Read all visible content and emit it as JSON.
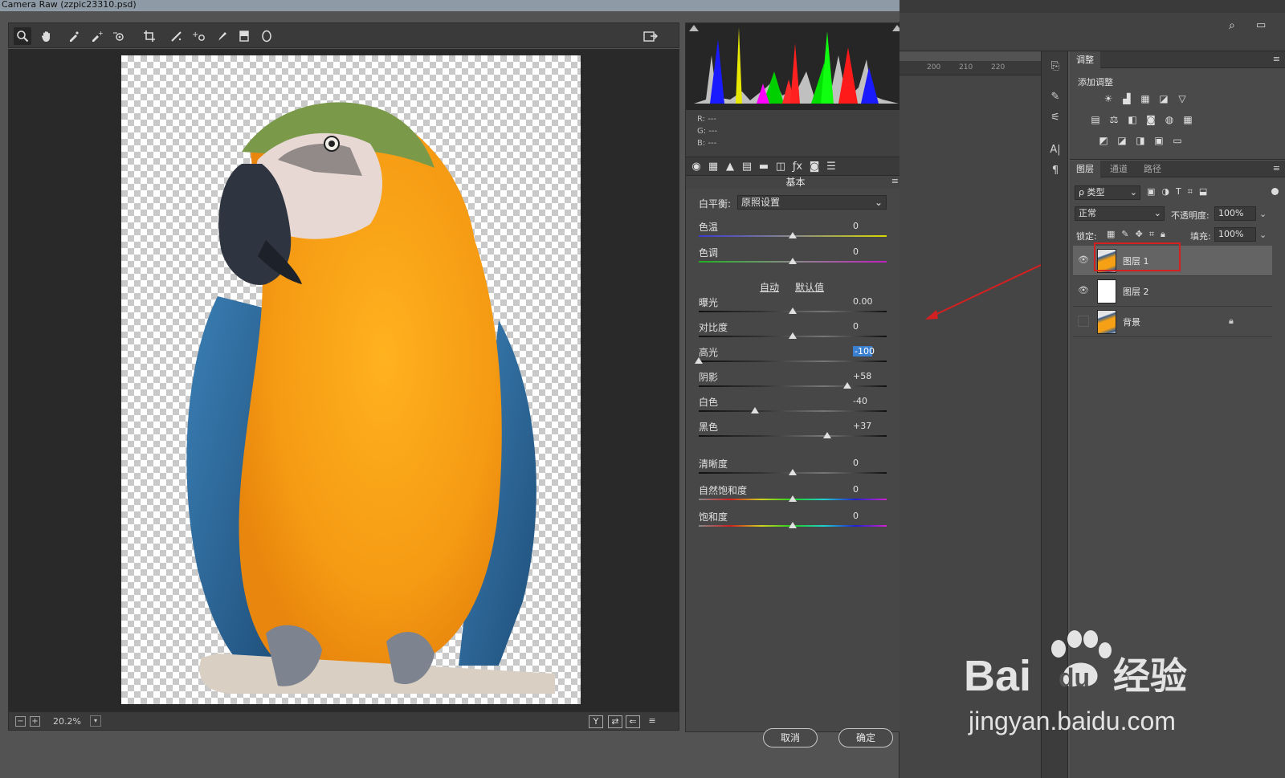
{
  "window": {
    "title": "Camera Raw (zzpic23310.psd)"
  },
  "toolbar": {
    "tools": [
      {
        "icon": "zoom-icon",
        "glyph": "🔍︎"
      },
      {
        "icon": "hand-icon",
        "glyph": "✋︎"
      },
      {
        "icon": "white-balance-icon",
        "glyph": "⁄"
      },
      {
        "icon": "color-sampler-icon",
        "glyph": "✧"
      },
      {
        "icon": "targeted-adjustment-icon",
        "glyph": "◎"
      },
      {
        "icon": "crop-icon",
        "glyph": "⌗"
      },
      {
        "icon": "straighten-icon",
        "glyph": "⟋"
      },
      {
        "icon": "spot-removal-icon",
        "glyph": "+o"
      },
      {
        "icon": "red-eye-icon",
        "glyph": "⊙"
      },
      {
        "icon": "adjustment-brush-icon",
        "glyph": "✎"
      },
      {
        "icon": "graduated-filter-icon",
        "glyph": "▯"
      },
      {
        "icon": "radial-filter-icon",
        "glyph": "○"
      }
    ],
    "export_icon": "↱"
  },
  "status": {
    "zoom": "20.2%",
    "zoom_minus": "−",
    "zoom_plus": "+",
    "btn_y": "Y",
    "btn_swap": "⇄",
    "btn_copy": "⇐",
    "btn_prefs": "≡"
  },
  "histogram": {
    "r": "R:  ---",
    "g": "G:  ---",
    "b": "B:  ---"
  },
  "panel": {
    "section_title": "基本",
    "section_menu": "≡",
    "tab_icons": [
      "◉",
      "▦",
      "▲",
      "▤",
      "▬",
      "◫",
      "ƒx",
      "◙",
      "☰"
    ],
    "white_balance_label": "白平衡:",
    "white_balance_value": "原照设置",
    "auto": "自动",
    "default": "默认值",
    "sliders": [
      {
        "label": "色温",
        "value": "0",
        "pos": 0.5,
        "track": "temp"
      },
      {
        "label": "色调",
        "value": "0",
        "pos": 0.5,
        "track": "tint"
      },
      {
        "label": "曝光",
        "value": "0.00",
        "pos": 0.5,
        "track": "gray"
      },
      {
        "label": "对比度",
        "value": "0",
        "pos": 0.5,
        "track": "gray"
      },
      {
        "label": "高光",
        "value": "-100",
        "pos": 0.0,
        "track": "gray",
        "selected": true
      },
      {
        "label": "阴影",
        "value": "+58",
        "pos": 0.79,
        "track": "gray"
      },
      {
        "label": "白色",
        "value": "-40",
        "pos": 0.3,
        "track": "gray"
      },
      {
        "label": "黑色",
        "value": "+37",
        "pos": 0.685,
        "track": "gray"
      },
      {
        "label": "清晰度",
        "value": "0",
        "pos": 0.5,
        "track": "gray"
      },
      {
        "label": "自然饱和度",
        "value": "0",
        "pos": 0.5,
        "track": "sat"
      },
      {
        "label": "饱和度",
        "value": "0",
        "pos": 0.5,
        "track": "sat"
      }
    ]
  },
  "buttons": {
    "cancel": "取消",
    "ok": "确定"
  },
  "ps": {
    "ruler": [
      "200",
      "210",
      "220"
    ],
    "adjust_tab": "调整",
    "add_adjustment": "添加调整",
    "layer_tabs": [
      "图层",
      "通道",
      "路径"
    ],
    "filter_kind": "ρ 类型",
    "blend_mode": "正常",
    "opacity_label": "不透明度:",
    "opacity_value": "100%",
    "lock_label": "锁定:",
    "fill_label": "填充:",
    "fill_value": "100%",
    "layers": [
      {
        "name": "图层 1",
        "visible": true,
        "selected": true,
        "thumb": "parrot"
      },
      {
        "name": "图层 2",
        "visible": true,
        "selected": false,
        "thumb": "white"
      },
      {
        "name": "背景",
        "visible": false,
        "selected": false,
        "thumb": "parrot",
        "locked": true
      }
    ]
  },
  "watermark": {
    "brand": "Bai",
    "brand2": "du",
    "cn": "经验",
    "url": "jingyan.baidu.com"
  },
  "colors": {
    "accent": "#3b7fd0",
    "highlight_box": "#d42020",
    "arrow": "#d42020"
  }
}
